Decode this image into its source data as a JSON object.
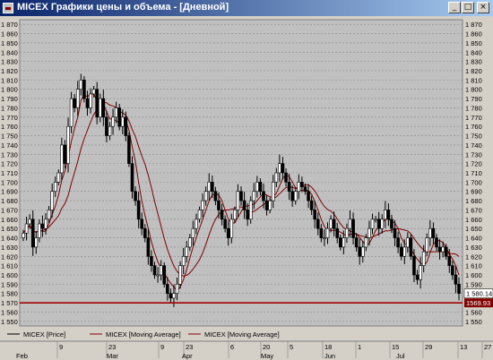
{
  "window": {
    "title": "MICEX Графики цены и объема - [Дневной]",
    "min_glyph": "_",
    "max_glyph": "□",
    "close_glyph": "×",
    "icon": "chart-app-icon"
  },
  "chart_data": {
    "type": "candlestick",
    "ylim": [
      1545,
      1875
    ],
    "y_ticks": [
      1550,
      1560,
      1570,
      1580,
      1590,
      1600,
      1610,
      1620,
      1630,
      1640,
      1650,
      1660,
      1670,
      1680,
      1690,
      1700,
      1710,
      1720,
      1730,
      1740,
      1750,
      1760,
      1770,
      1780,
      1790,
      1800,
      1810,
      1820,
      1830,
      1840,
      1850,
      1860,
      1870
    ],
    "grid": true,
    "x_day_labels": [
      "9",
      "23",
      "9",
      "23",
      "6",
      "20",
      "5",
      "18",
      "1",
      "15",
      "29",
      "13",
      "27"
    ],
    "x_month_labels": [
      "Feb",
      "Mar",
      "Apr",
      "May",
      "Jun",
      "Jul"
    ],
    "last_price_label": "1 580.14",
    "support_line_label": "1569.93",
    "support_line_value": 1569.93,
    "legend": [
      {
        "name": "MICEX [Price]",
        "color": "#000000"
      },
      {
        "name": "MICEX [Moving Average]",
        "color": "#800000"
      },
      {
        "name": "MICEX [Moving Average]",
        "color": "#800000"
      }
    ],
    "close": [
      1645,
      1655,
      1660,
      1630,
      1640,
      1655,
      1650,
      1660,
      1670,
      1690,
      1700,
      1710,
      1740,
      1720,
      1760,
      1790,
      1780,
      1800,
      1810,
      1790,
      1780,
      1795,
      1800,
      1770,
      1790,
      1770,
      1750,
      1760,
      1770,
      1780,
      1760,
      1770,
      1750,
      1720,
      1690,
      1680,
      1660,
      1650,
      1640,
      1620,
      1610,
      1600,
      1600,
      1610,
      1590,
      1580,
      1575,
      1580,
      1590,
      1610,
      1620,
      1630,
      1640,
      1650,
      1660,
      1670,
      1680,
      1690,
      1700,
      1690,
      1680,
      1670,
      1660,
      1650,
      1640,
      1660,
      1670,
      1690,
      1680,
      1670,
      1660,
      1680,
      1690,
      1700,
      1690,
      1680,
      1670,
      1680,
      1700,
      1710,
      1720,
      1710,
      1700,
      1690,
      1680,
      1690,
      1700,
      1695,
      1690,
      1680,
      1670,
      1660,
      1650,
      1640,
      1640,
      1650,
      1660,
      1650,
      1640,
      1630,
      1640,
      1650,
      1660,
      1640,
      1630,
      1620,
      1630,
      1640,
      1650,
      1660,
      1660,
      1650,
      1660,
      1670,
      1660,
      1650,
      1640,
      1630,
      1620,
      1630,
      1640,
      1620,
      1600,
      1595,
      1610,
      1625,
      1640,
      1650,
      1640,
      1630,
      1625,
      1630,
      1620,
      1610,
      1600,
      1590,
      1580
    ]
  }
}
